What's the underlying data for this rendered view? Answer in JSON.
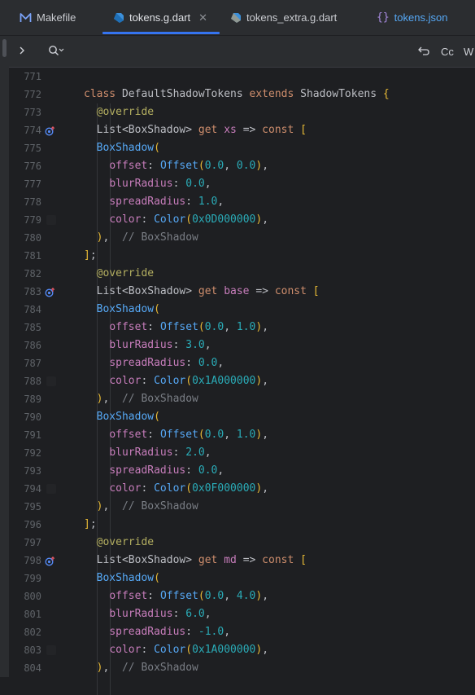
{
  "tabs": [
    {
      "label": "Makefile",
      "icon": "makefile-icon",
      "active": false
    },
    {
      "label": "tokens.g.dart",
      "icon": "dart-file-icon",
      "active": true
    },
    {
      "label": "tokens_extra.g.dart",
      "icon": "dart-file-icon",
      "active": false
    },
    {
      "label": "tokens.json",
      "icon": "json-file-icon",
      "active": false
    }
  ],
  "toolbar": {
    "expand_icon": "chevron-right-icon",
    "search_icon": "search-icon",
    "undo_icon": "undo-icon",
    "match_case_label": "Cc",
    "words_label": "W"
  },
  "colors": {
    "keyword": "#cf8e6d",
    "class_name": "#bcbec4",
    "annotation": "#b3ae60",
    "getter": "#c77dbb",
    "field": "#c77dbb",
    "number": "#2aacb8",
    "type_call": "#56a8f5",
    "comment": "#7a7e85",
    "bracket": "#e8ba36",
    "text": "#bcbec4"
  },
  "code_lines": [
    {
      "num": "771",
      "tokens": []
    },
    {
      "num": "772",
      "tokens": [
        [
          "class ",
          "keyword"
        ],
        [
          "DefaultShadowTokens ",
          "class_name"
        ],
        [
          "extends ",
          "keyword"
        ],
        [
          "ShadowTokens ",
          "class_name"
        ],
        [
          "{",
          "bracket"
        ]
      ]
    },
    {
      "num": "773",
      "tokens": [
        [
          "  "
        ],
        [
          "@override",
          "annotation"
        ]
      ]
    },
    {
      "num": "774",
      "gutter": "override",
      "tokens": [
        [
          "  "
        ],
        [
          "List",
          "text"
        ],
        [
          "<BoxShadow> ",
          "text"
        ],
        [
          "get ",
          "keyword"
        ],
        [
          "xs ",
          "getter"
        ],
        [
          "=> ",
          "text"
        ],
        [
          "const ",
          "keyword"
        ],
        [
          "[",
          "bracket"
        ]
      ]
    },
    {
      "num": "775",
      "tokens": [
        [
          "  "
        ],
        [
          "BoxShadow",
          "type_call"
        ],
        [
          "(",
          "bracket"
        ]
      ]
    },
    {
      "num": "776",
      "tokens": [
        [
          "    "
        ],
        [
          "offset",
          "field"
        ],
        [
          ": ",
          "text"
        ],
        [
          "Offset",
          "type_call"
        ],
        [
          "(",
          "bracket"
        ],
        [
          "0.0",
          "number"
        ],
        [
          ", ",
          "text"
        ],
        [
          "0.0",
          "number"
        ],
        [
          ")",
          "bracket"
        ],
        [
          ",",
          "text"
        ]
      ]
    },
    {
      "num": "777",
      "tokens": [
        [
          "    "
        ],
        [
          "blurRadius",
          "field"
        ],
        [
          ": ",
          "text"
        ],
        [
          "0.0",
          "number"
        ],
        [
          ",",
          "text"
        ]
      ]
    },
    {
      "num": "778",
      "tokens": [
        [
          "    "
        ],
        [
          "spreadRadius",
          "field"
        ],
        [
          ": ",
          "text"
        ],
        [
          "1.0",
          "number"
        ],
        [
          ",",
          "text"
        ]
      ]
    },
    {
      "num": "779",
      "gutter": "square",
      "tokens": [
        [
          "    "
        ],
        [
          "color",
          "field"
        ],
        [
          ": ",
          "text"
        ],
        [
          "Color",
          "type_call"
        ],
        [
          "(",
          "bracket"
        ],
        [
          "0x0D000000",
          "number"
        ],
        [
          ")",
          "bracket"
        ],
        [
          ",",
          "text"
        ]
      ]
    },
    {
      "num": "780",
      "tokens": [
        [
          "  "
        ],
        [
          ")",
          "bracket"
        ],
        [
          ",  ",
          "text"
        ],
        [
          "// BoxShadow",
          "comment"
        ]
      ]
    },
    {
      "num": "781",
      "tokens": [
        [
          "]",
          "bracket"
        ],
        [
          ";",
          "text"
        ]
      ]
    },
    {
      "num": "782",
      "tokens": [
        [
          "  "
        ],
        [
          "@override",
          "annotation"
        ]
      ]
    },
    {
      "num": "783",
      "gutter": "override",
      "tokens": [
        [
          "  "
        ],
        [
          "List",
          "text"
        ],
        [
          "<BoxShadow> ",
          "text"
        ],
        [
          "get ",
          "keyword"
        ],
        [
          "base ",
          "getter"
        ],
        [
          "=> ",
          "text"
        ],
        [
          "const ",
          "keyword"
        ],
        [
          "[",
          "bracket"
        ]
      ]
    },
    {
      "num": "784",
      "tokens": [
        [
          "  "
        ],
        [
          "BoxShadow",
          "type_call"
        ],
        [
          "(",
          "bracket"
        ]
      ]
    },
    {
      "num": "785",
      "tokens": [
        [
          "    "
        ],
        [
          "offset",
          "field"
        ],
        [
          ": ",
          "text"
        ],
        [
          "Offset",
          "type_call"
        ],
        [
          "(",
          "bracket"
        ],
        [
          "0.0",
          "number"
        ],
        [
          ", ",
          "text"
        ],
        [
          "1.0",
          "number"
        ],
        [
          ")",
          "bracket"
        ],
        [
          ",",
          "text"
        ]
      ]
    },
    {
      "num": "786",
      "tokens": [
        [
          "    "
        ],
        [
          "blurRadius",
          "field"
        ],
        [
          ": ",
          "text"
        ],
        [
          "3.0",
          "number"
        ],
        [
          ",",
          "text"
        ]
      ]
    },
    {
      "num": "787",
      "tokens": [
        [
          "    "
        ],
        [
          "spreadRadius",
          "field"
        ],
        [
          ": ",
          "text"
        ],
        [
          "0.0",
          "number"
        ],
        [
          ",",
          "text"
        ]
      ]
    },
    {
      "num": "788",
      "gutter": "square",
      "tokens": [
        [
          "    "
        ],
        [
          "color",
          "field"
        ],
        [
          ": ",
          "text"
        ],
        [
          "Color",
          "type_call"
        ],
        [
          "(",
          "bracket"
        ],
        [
          "0x1A000000",
          "number"
        ],
        [
          ")",
          "bracket"
        ],
        [
          ",",
          "text"
        ]
      ]
    },
    {
      "num": "789",
      "tokens": [
        [
          "  "
        ],
        [
          ")",
          "bracket"
        ],
        [
          ",  ",
          "text"
        ],
        [
          "// BoxShadow",
          "comment"
        ]
      ]
    },
    {
      "num": "790",
      "tokens": [
        [
          "  "
        ],
        [
          "BoxShadow",
          "type_call"
        ],
        [
          "(",
          "bracket"
        ]
      ]
    },
    {
      "num": "791",
      "tokens": [
        [
          "    "
        ],
        [
          "offset",
          "field"
        ],
        [
          ": ",
          "text"
        ],
        [
          "Offset",
          "type_call"
        ],
        [
          "(",
          "bracket"
        ],
        [
          "0.0",
          "number"
        ],
        [
          ", ",
          "text"
        ],
        [
          "1.0",
          "number"
        ],
        [
          ")",
          "bracket"
        ],
        [
          ",",
          "text"
        ]
      ]
    },
    {
      "num": "792",
      "tokens": [
        [
          "    "
        ],
        [
          "blurRadius",
          "field"
        ],
        [
          ": ",
          "text"
        ],
        [
          "2.0",
          "number"
        ],
        [
          ",",
          "text"
        ]
      ]
    },
    {
      "num": "793",
      "tokens": [
        [
          "    "
        ],
        [
          "spreadRadius",
          "field"
        ],
        [
          ": ",
          "text"
        ],
        [
          "0.0",
          "number"
        ],
        [
          ",",
          "text"
        ]
      ]
    },
    {
      "num": "794",
      "gutter": "square",
      "tokens": [
        [
          "    "
        ],
        [
          "color",
          "field"
        ],
        [
          ": ",
          "text"
        ],
        [
          "Color",
          "type_call"
        ],
        [
          "(",
          "bracket"
        ],
        [
          "0x0F000000",
          "number"
        ],
        [
          ")",
          "bracket"
        ],
        [
          ",",
          "text"
        ]
      ]
    },
    {
      "num": "795",
      "tokens": [
        [
          "  "
        ],
        [
          ")",
          "bracket"
        ],
        [
          ",  ",
          "text"
        ],
        [
          "// BoxShadow",
          "comment"
        ]
      ]
    },
    {
      "num": "796",
      "tokens": [
        [
          "]",
          "bracket"
        ],
        [
          ";",
          "text"
        ]
      ]
    },
    {
      "num": "797",
      "tokens": [
        [
          "  "
        ],
        [
          "@override",
          "annotation"
        ]
      ]
    },
    {
      "num": "798",
      "gutter": "override",
      "tokens": [
        [
          "  "
        ],
        [
          "List",
          "text"
        ],
        [
          "<BoxShadow> ",
          "text"
        ],
        [
          "get ",
          "keyword"
        ],
        [
          "md ",
          "getter"
        ],
        [
          "=> ",
          "text"
        ],
        [
          "const ",
          "keyword"
        ],
        [
          "[",
          "bracket"
        ]
      ]
    },
    {
      "num": "799",
      "tokens": [
        [
          "  "
        ],
        [
          "BoxShadow",
          "type_call"
        ],
        [
          "(",
          "bracket"
        ]
      ]
    },
    {
      "num": "800",
      "tokens": [
        [
          "    "
        ],
        [
          "offset",
          "field"
        ],
        [
          ": ",
          "text"
        ],
        [
          "Offset",
          "type_call"
        ],
        [
          "(",
          "bracket"
        ],
        [
          "0.0",
          "number"
        ],
        [
          ", ",
          "text"
        ],
        [
          "4.0",
          "number"
        ],
        [
          ")",
          "bracket"
        ],
        [
          ",",
          "text"
        ]
      ]
    },
    {
      "num": "801",
      "tokens": [
        [
          "    "
        ],
        [
          "blurRadius",
          "field"
        ],
        [
          ": ",
          "text"
        ],
        [
          "6.0",
          "number"
        ],
        [
          ",",
          "text"
        ]
      ]
    },
    {
      "num": "802",
      "tokens": [
        [
          "    "
        ],
        [
          "spreadRadius",
          "field"
        ],
        [
          ": ",
          "text"
        ],
        [
          "-1.0",
          "number"
        ],
        [
          ",",
          "text"
        ]
      ]
    },
    {
      "num": "803",
      "gutter": "square",
      "tokens": [
        [
          "    "
        ],
        [
          "color",
          "field"
        ],
        [
          ": ",
          "text"
        ],
        [
          "Color",
          "type_call"
        ],
        [
          "(",
          "bracket"
        ],
        [
          "0x1A000000",
          "number"
        ],
        [
          ")",
          "bracket"
        ],
        [
          ",",
          "text"
        ]
      ]
    },
    {
      "num": "804",
      "tokens": [
        [
          "  "
        ],
        [
          ")",
          "bracket"
        ],
        [
          ",  ",
          "text"
        ],
        [
          "// BoxShadow",
          "comment"
        ]
      ]
    }
  ]
}
